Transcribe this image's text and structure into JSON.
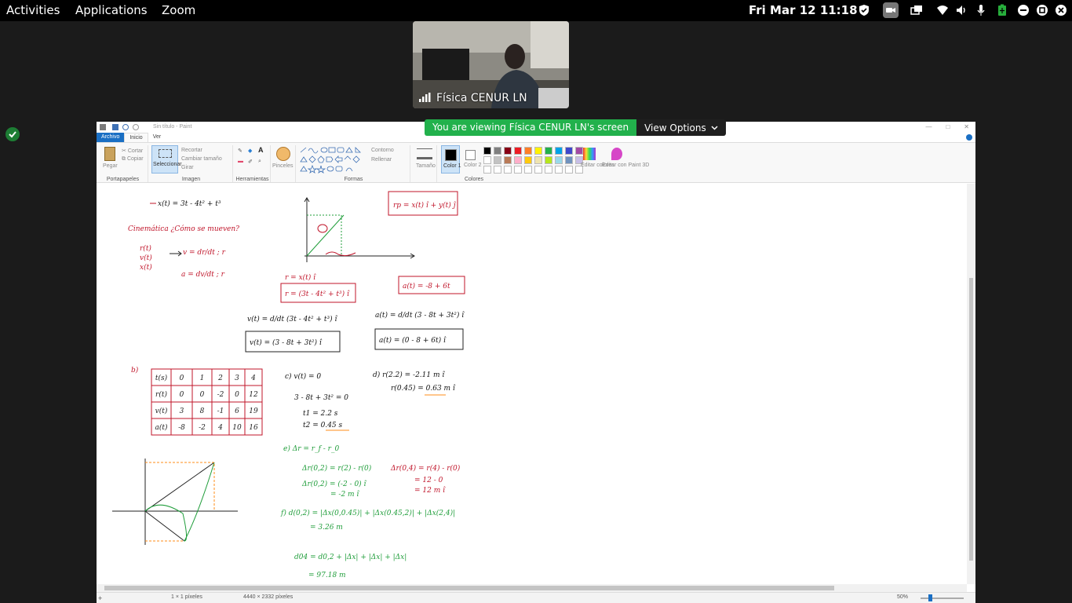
{
  "topbar": {
    "activities": "Activities",
    "applications": "Applications",
    "zoom": "Zoom",
    "clock": "Fri Mar 12  11:18"
  },
  "participant": {
    "name": "Física CENUR LN"
  },
  "share_banner": {
    "text": "You are viewing Física CENUR LN's screen",
    "view_options": "View Options"
  },
  "paint": {
    "title": "Sin título - Paint",
    "tabs": [
      "Archivo",
      "Inicio",
      "Ver"
    ],
    "ribbon": {
      "pegar": "Pegar",
      "cortar": "Cortar",
      "copiar": "Copiar",
      "portapapeles": "Portapapeles",
      "recortar": "Recortar",
      "cambiar_tamano": "Cambiar tamaño",
      "girar": "Girar",
      "seleccionar": "Seleccionar",
      "imagen": "Imagen",
      "herramientas": "Herramientas",
      "pinceles": "Pinceles",
      "formas": "Formas",
      "contorno": "Contorno",
      "rellenar": "Rellenar",
      "tamano": "Tamaño",
      "color1": "Color 1",
      "color2": "Color 2",
      "editar_colores": "Editar colores",
      "editar_paint3d": "Editar con Paint 3D",
      "colores": "Colores"
    },
    "palette_colors": [
      "#000000",
      "#7f7f7f",
      "#880015",
      "#ed1c24",
      "#ff7f27",
      "#fff200",
      "#22b14c",
      "#00a2e8",
      "#3f48cc",
      "#a349a4",
      "#ffffff",
      "#c3c3c3",
      "#b97a57",
      "#ffaec9",
      "#ffc90e",
      "#efe4b0",
      "#b5e61d",
      "#99d9ea",
      "#7092be",
      "#c8bfe7"
    ],
    "status": {
      "cursor": "1 × 1 píxeles",
      "size": "4440 × 2332 píxeles",
      "zoom": "50%"
    }
  },
  "drawing": {
    "x_eq": "x(t) = 3t - 4t² + t³",
    "cinematica": "Cinemática ¿Cómo se mueven?",
    "r_vec": "r(t)",
    "v_vec": "v(t)",
    "x_t": "x(t)",
    "v_def": "v = dr/dt ; r",
    "a_def": "a = dv/dt ; r",
    "rp": "rp = x(t) î + y(t) ĵ",
    "r_xi": "r = x(t) î",
    "r_full": "r = (3t - 4t² + t³) î",
    "a_box": "a(t) = -8 + 6t",
    "v_deriv": "v(t) = d/dt (3t - 4t² + t³) î",
    "a_deriv": "a(t) = d/dt (3 - 8t + 3t²) î",
    "v_box": "v(t) = (3 - 8t + 3t²) î",
    "a_full": "a(t) = (0 - 8 + 6t) î",
    "part_b": "b)",
    "table": {
      "rows": [
        [
          "t(s)",
          "0",
          "1",
          "2",
          "3",
          "4"
        ],
        [
          "r(t)",
          "0",
          "0",
          "-2",
          "0",
          "12"
        ],
        [
          "v(t)",
          "3",
          "8",
          "-1",
          "6",
          "19"
        ],
        [
          "a(t)",
          "-8",
          "-2",
          "4",
          "10",
          "16"
        ]
      ]
    },
    "c1": "c)  v(t) = 0",
    "c2": "3 - 8t + 3t² = 0",
    "t1": "t1 = 2.2 s",
    "t2": "t2 = 0.45 s",
    "d1": "d)  r(2.2) = -2.11 m î",
    "d2": "r(0.45) = 0.63 m î",
    "e1": "e)  Δr = r_f - r_0",
    "e2": "Δr(0,2) = r(2) - r(0)",
    "e3": "Δr(0,2) = (-2 - 0) î",
    "e4": "= -2 m î",
    "e5": "Δr(0,4) = r(4) - r(0)",
    "e6": "= 12 - 0",
    "e7": "= 12 m î",
    "f1": "f)  d(0,2) = |Δx(0,0.45)| + |Δx(0.45,2)| + |Δx(2,4)|",
    "f2": "= 3.26 m",
    "f3": "d04 = d0,2 + |Δx| + |Δx| + |Δx|",
    "f4": "= 97.18 m"
  }
}
